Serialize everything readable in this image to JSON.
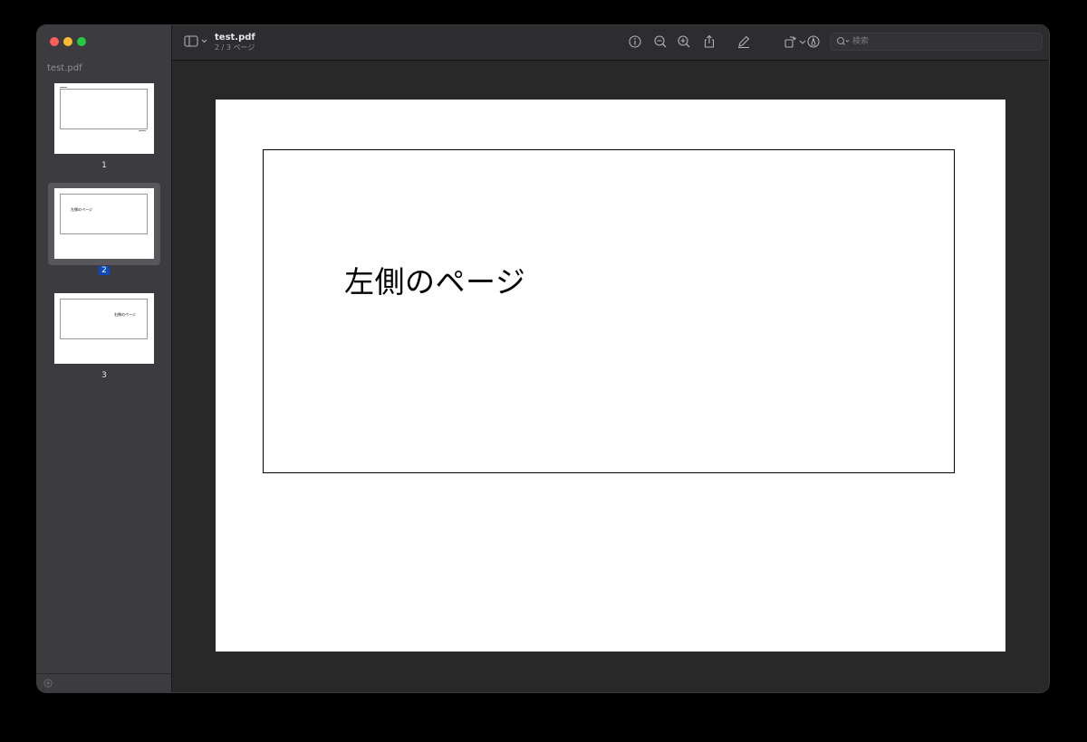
{
  "window": {
    "filename": "test.pdf",
    "page_indicator": "2 / 3 ページ"
  },
  "sidebar": {
    "title": "test.pdf",
    "pages": [
      {
        "number": "1",
        "text": "",
        "selected": false
      },
      {
        "number": "2",
        "text": "左側のページ",
        "selected": true
      },
      {
        "number": "3",
        "text": "右側のページ",
        "selected": false
      }
    ]
  },
  "toolbar": {
    "search_placeholder": "検索",
    "icons": [
      "sidebar-toggle-icon",
      "info-icon",
      "zoom-out-icon",
      "zoom-in-icon",
      "share-icon",
      "highlight-pen-icon",
      "chevron-down-icon",
      "rotate-icon",
      "markup-icon",
      "search-icon"
    ]
  },
  "document": {
    "current_page_text": "左側のページ"
  },
  "colors": {
    "sidebar_bg": "#3c3c40",
    "toolbar_bg": "#2d2d30",
    "canvas_bg": "#282828",
    "selection_accent": "#0a4cbf",
    "page_bg": "#ffffff"
  }
}
